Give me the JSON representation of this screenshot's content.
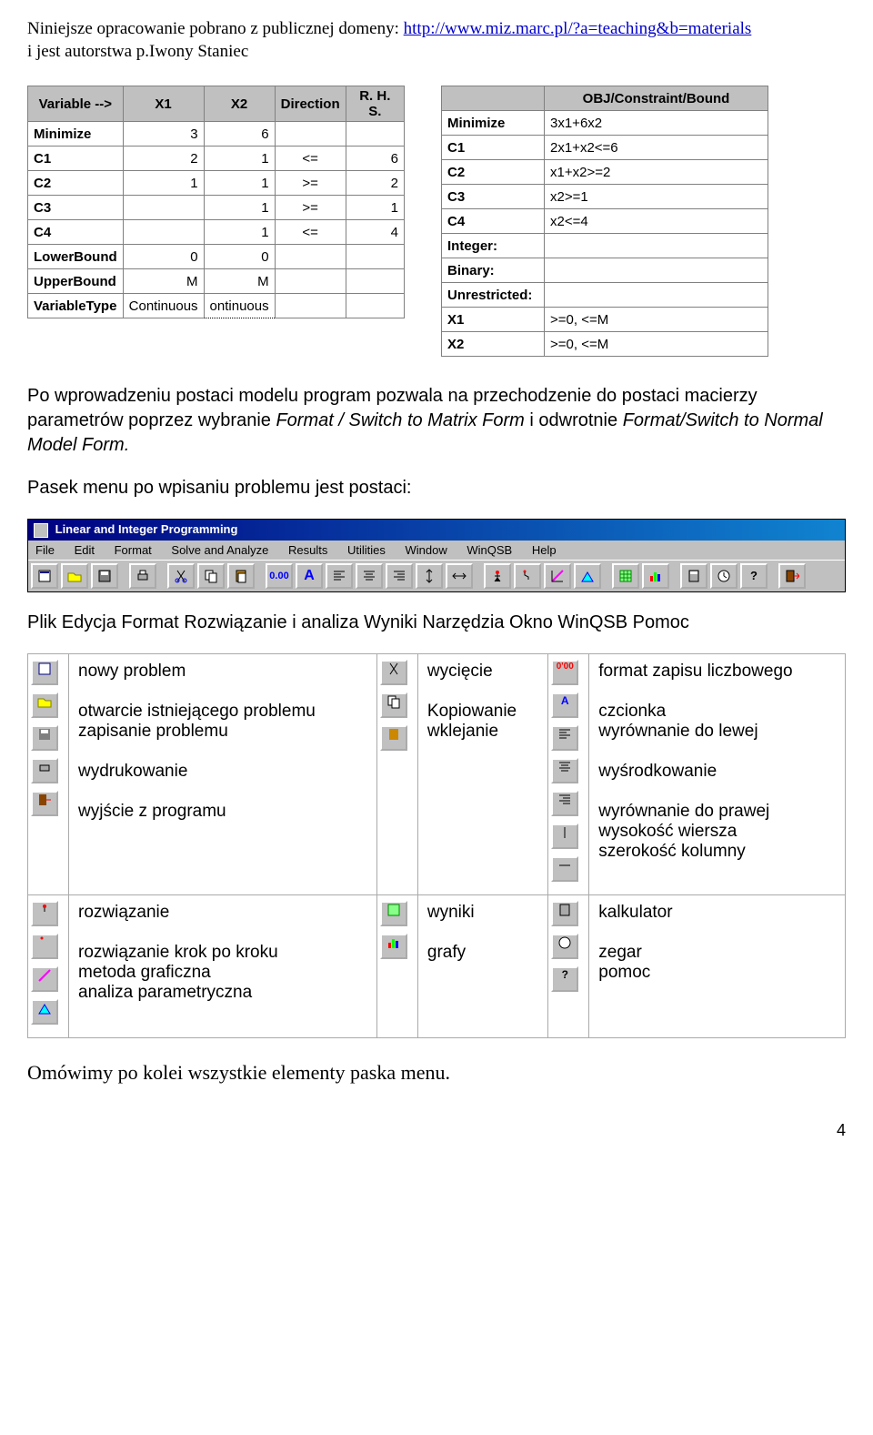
{
  "header": {
    "line1_prefix": "Niniejsze opracowanie pobrano z publicznej domeny: ",
    "url": "http://www.miz.marc.pl/?a=teaching&b=materials",
    "line2": "i jest autorstwa p.Iwony Staniec"
  },
  "left_table": {
    "headers": [
      "Variable -->",
      "X1",
      "X2",
      "Direction",
      "R. H. S."
    ],
    "rows": [
      [
        "Minimize",
        "3",
        "6",
        "",
        ""
      ],
      [
        "C1",
        "2",
        "1",
        "<=",
        "6"
      ],
      [
        "C2",
        "1",
        "1",
        ">=",
        "2"
      ],
      [
        "C3",
        "",
        "1",
        ">=",
        "1"
      ],
      [
        "C4",
        "",
        "1",
        "<=",
        "4"
      ],
      [
        "LowerBound",
        "0",
        "0",
        "",
        ""
      ],
      [
        "UpperBound",
        "M",
        "M",
        "",
        ""
      ],
      [
        "VariableType",
        "Continuous",
        "ontinuous",
        "",
        ""
      ]
    ]
  },
  "right_table": {
    "headers": [
      "",
      "OBJ/Constraint/Bound"
    ],
    "rows": [
      [
        "Minimize",
        "3x1+6x2"
      ],
      [
        "C1",
        "2x1+x2<=6"
      ],
      [
        "C2",
        "x1+x2>=2"
      ],
      [
        "C3",
        "x2>=1"
      ],
      [
        "C4",
        "x2<=4"
      ],
      [
        "Integer:",
        ""
      ],
      [
        "Binary:",
        ""
      ],
      [
        "Unrestricted:",
        ""
      ],
      [
        "X1",
        ">=0, <=M"
      ],
      [
        "X2",
        ">=0, <=M"
      ]
    ]
  },
  "para1": "Po wprowadzeniu postaci modelu program pozwala na przechodzenie do postaci macierzy parametrów poprzez wybranie ",
  "para1_italic1": "Format / Switch to Matrix Form",
  "para1_mid": " i odwrotnie ",
  "para1_italic2": "Format/Switch to Normal Model Form.",
  "para2": "Pasek menu po wpisaniu problemu jest postaci:",
  "menubar": {
    "title": "Linear and Integer Programming",
    "items": [
      "File",
      "Edit",
      "Format",
      "Solve and Analyze",
      "Results",
      "Utilities",
      "Window",
      "WinQSB",
      "Help"
    ]
  },
  "menu_translation": "Plik Edycja Format Rozwiązanie i analiza Wyniki Narzędzia Okno WinQSB Pomoc",
  "legend": {
    "row1": {
      "c1_items": [
        "nowy problem",
        "otwarcie istniejącego problemu",
        "zapisanie problemu",
        "wydrukowanie",
        "wyjście z programu"
      ],
      "c2_items": [
        "wycięcie",
        "Kopiowanie",
        "wklejanie"
      ],
      "c3_items": [
        "format zapisu liczbowego",
        "czcionka",
        "wyrównanie do lewej",
        "wyśrodkowanie",
        "wyrównanie do prawej",
        "wysokość wiersza",
        "szerokość kolumny"
      ]
    },
    "row2": {
      "c1_items": [
        "rozwiązanie",
        "rozwiązanie krok po kroku",
        "metoda graficzna",
        "analiza parametryczna"
      ],
      "c2_items": [
        "wyniki",
        "grafy"
      ],
      "c3_items": [
        "kalkulator",
        "zegar",
        "pomoc"
      ]
    }
  },
  "closing": "Omówimy po kolei wszystkie elementy paska menu.",
  "page_number": "4"
}
